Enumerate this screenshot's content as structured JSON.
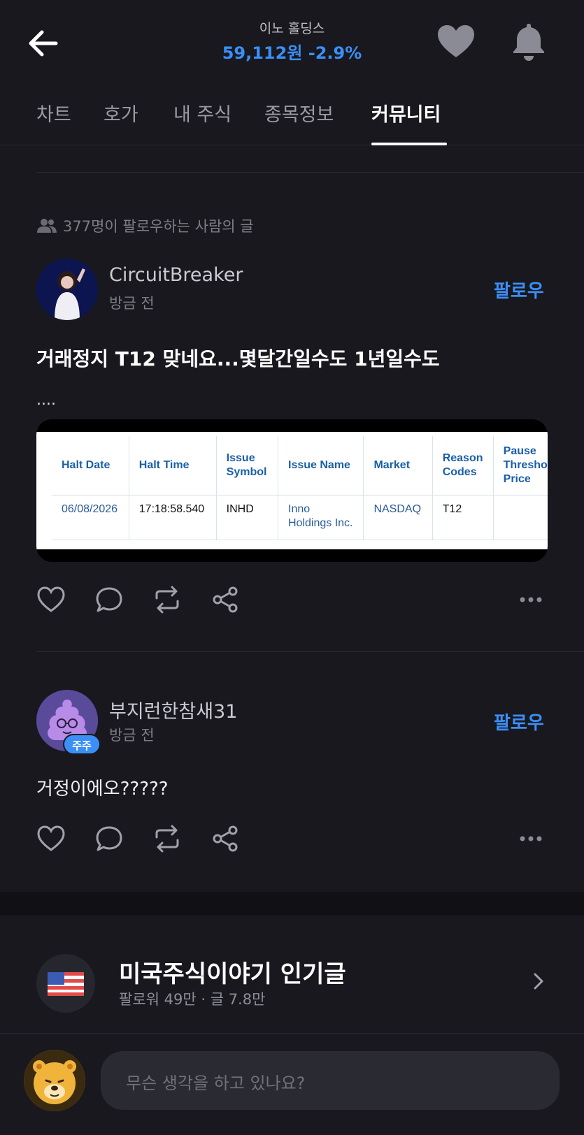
{
  "header": {
    "stock_name": "이노 홀딩스",
    "price_line": "59,112원 -2.9%"
  },
  "tabs": [
    "차트",
    "호가",
    "내 주식",
    "종목정보",
    "커뮤니티"
  ],
  "feed": {
    "followers_note": "377명이 팔로우하는 사람의 글"
  },
  "posts": [
    {
      "author": "CircuitBreaker",
      "time": "방금 전",
      "follow_label": "팔로우",
      "title": "거래정지 T12 맞네요...몇달간일수도 1년일수도",
      "body": "....",
      "image_table": {
        "headers": [
          "Halt Date",
          "Halt Time",
          "Issue Symbol",
          "Issue Name",
          "Market",
          "Reason Codes",
          "Pause Threshold Price"
        ],
        "row": [
          "06/08/2026",
          "17:18:58.540",
          "INHD",
          "Inno Holdings Inc.",
          "NASDAQ",
          "T12",
          ""
        ]
      }
    },
    {
      "author": "부지런한참새31",
      "time": "방금 전",
      "follow_label": "팔로우",
      "badge": "주주",
      "body": "거정이에오?????"
    }
  ],
  "community": {
    "title": "미국주식이야기 인기글",
    "subtitle": "팔로워 49만 · 글 7.8만"
  },
  "compose": {
    "placeholder": "무슨 생각을 하고 있나요?"
  },
  "colors": {
    "accent": "#3b8ff7",
    "background": "#18181e"
  }
}
